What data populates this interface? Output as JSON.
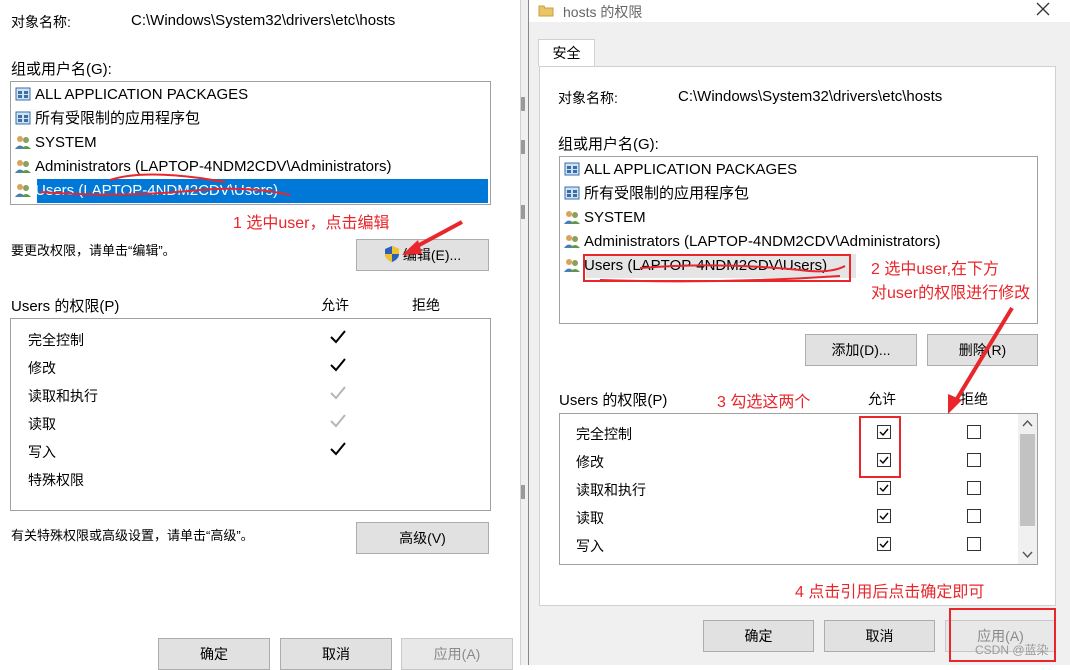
{
  "left": {
    "object_label": "对象名称:",
    "object_path": "C:\\Windows\\System32\\drivers\\etc\\hosts",
    "groups_label": "组或用户名(G):",
    "groups": [
      "ALL APPLICATION PACKAGES",
      "所有受限制的应用程序包",
      "SYSTEM",
      "Administrators (LAPTOP-4NDM2CDV\\Administrators)",
      "Users (LAPTOP-4NDM2CDV\\Users)"
    ],
    "change_hint": "要更改权限，请单击“编辑”。",
    "edit_button": "编辑(E)...",
    "perm_title": "Users 的权限(P)",
    "allow_header": "允许",
    "deny_header": "拒绝",
    "permissions": [
      {
        "name": "完全控制",
        "allow": "check"
      },
      {
        "name": "修改",
        "allow": "check"
      },
      {
        "name": "读取和执行",
        "allow": "gray"
      },
      {
        "name": "读取",
        "allow": "gray"
      },
      {
        "name": "写入",
        "allow": "check"
      },
      {
        "name": "特殊权限",
        "allow": "none"
      }
    ],
    "advanced_hint": "有关特殊权限或高级设置，请单击“高级”。",
    "advanced_button": "高级(V)",
    "ok_button": "确定",
    "cancel_button": "取消",
    "apply_button": "应用(A)"
  },
  "right": {
    "window_title": "hosts 的权限",
    "tab_security": "安全",
    "object_label": "对象名称:",
    "object_path": "C:\\Windows\\System32\\drivers\\etc\\hosts",
    "groups_label": "组或用户名(G):",
    "groups": [
      "ALL APPLICATION PACKAGES",
      "所有受限制的应用程序包",
      "SYSTEM",
      "Administrators (LAPTOP-4NDM2CDV\\Administrators)",
      "Users (LAPTOP-4NDM2CDV\\Users)"
    ],
    "add_button": "添加(D)...",
    "remove_button": "删除(R)",
    "perm_title": "Users 的权限(P)",
    "allow_header": "允许",
    "deny_header": "拒绝",
    "permissions": [
      {
        "name": "完全控制",
        "allow": true,
        "deny": false
      },
      {
        "name": "修改",
        "allow": true,
        "deny": false
      },
      {
        "name": "读取和执行",
        "allow": true,
        "deny": false
      },
      {
        "name": "读取",
        "allow": true,
        "deny": false
      },
      {
        "name": "写入",
        "allow": true,
        "deny": false
      }
    ],
    "ok_button": "确定",
    "cancel_button": "取消",
    "apply_button": "应用(A)"
  },
  "annotations": {
    "step1": "1 选中user，点击编辑",
    "step2_line1": "2 选中user,在下方",
    "step2_line2": "对user的权限进行修改",
    "step3": "3 勾选这两个",
    "step4": "4 点击引用后点击确定即可"
  },
  "watermark": "CSDN @蓝染",
  "colors": {
    "annotation": "#e8262b",
    "selection": "#0078d7"
  }
}
